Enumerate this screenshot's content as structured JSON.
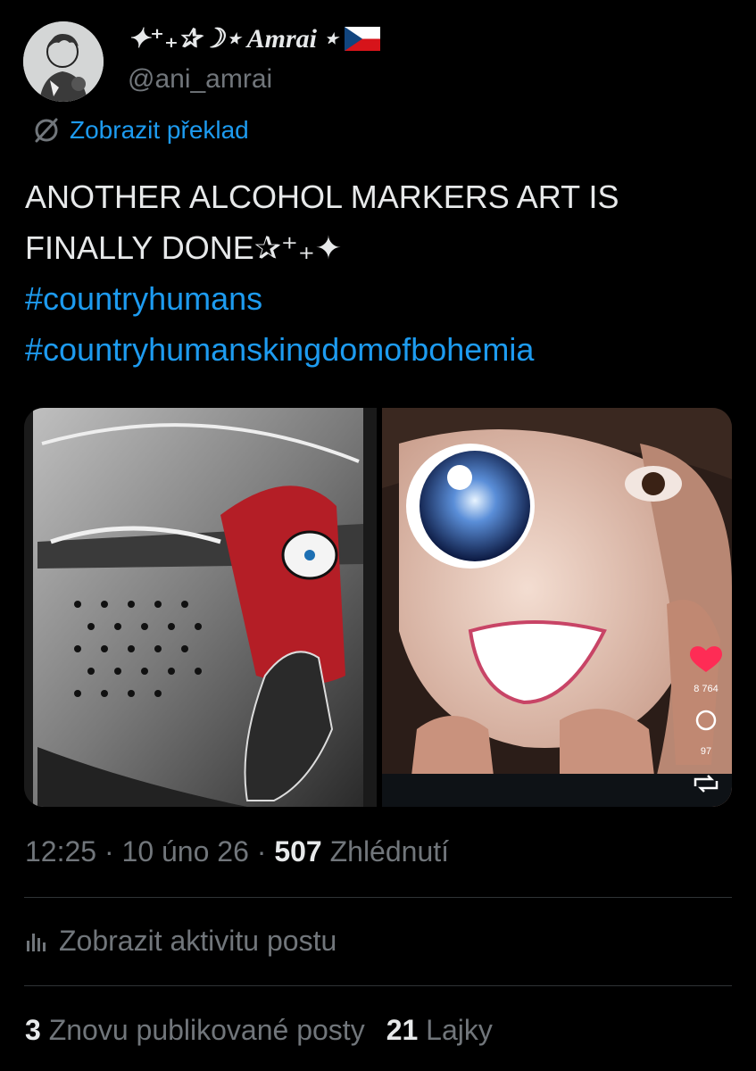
{
  "author": {
    "display_name_prefix": "✦⁺₊✰☽⋆",
    "display_name": "Amrai",
    "display_name_suffix": "⋆",
    "flag_icon": "czech-flag-icon",
    "handle": "@ani_amrai"
  },
  "translate": {
    "icon": "translate-icon",
    "label": "Zobrazit překlad"
  },
  "tweet": {
    "line1": "ANOTHER ALCOHOL MARKERS ART IS",
    "line2": "FINALLY DONE✰⁺₊✦",
    "hashtag1": "#countryhumans",
    "hashtag2": "#countryhumanskingdomofbohemia"
  },
  "media": {
    "left_image": "knight-helmet-drawing",
    "right_image": "doll-mask-photo",
    "overlay": {
      "like_count": "8 764",
      "comment_count": "97",
      "heart_color": "#fe2c55"
    }
  },
  "meta": {
    "time": "12:25",
    "date": "10 úno 26",
    "views": "507",
    "views_label": "Zhlédnutí"
  },
  "activity": {
    "icon": "bar-chart-icon",
    "label": "Zobrazit aktivitu postu"
  },
  "stats": {
    "reposts": "3",
    "reposts_label": "Znovu publikované posty",
    "likes": "21",
    "likes_label": "Lajky"
  },
  "colors": {
    "accent": "#1d9bf0",
    "text": "#e7e9ea",
    "muted": "#71767b",
    "background": "#000000"
  }
}
